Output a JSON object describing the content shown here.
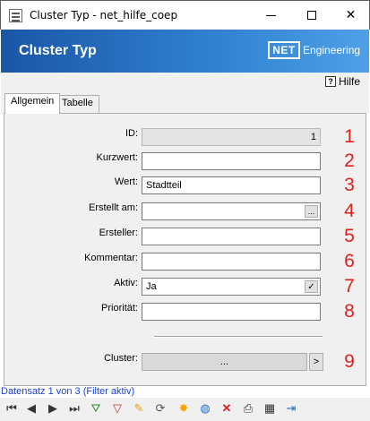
{
  "window": {
    "title": "Cluster Typ - net_hilfe_coep",
    "minimize_glyph": "—",
    "maximize_glyph": "□",
    "close_glyph": "✕"
  },
  "header": {
    "title": "Cluster Typ",
    "logo_text": "NET",
    "logo_suffix": "Engineering",
    "brand_gradient": [
      "#1a56a6",
      "#4ea0e6"
    ]
  },
  "help": {
    "label": "Hilfe",
    "icon": "help-icon",
    "icon_glyph": "?"
  },
  "tabs": [
    {
      "label": "Allgemein",
      "active": true
    },
    {
      "label": "Tabelle",
      "active": false
    }
  ],
  "form": {
    "id": {
      "label": "ID:",
      "value": "1",
      "number": "1"
    },
    "kurzwert": {
      "label": "Kurzwert:",
      "value": "",
      "number": "2"
    },
    "wert": {
      "label": "Wert:",
      "value": "Stadtteil",
      "number": "3"
    },
    "erstellt_am": {
      "label": "Erstellt am:",
      "value": "",
      "button": "...",
      "number": "4"
    },
    "ersteller": {
      "label": "Ersteller:",
      "value": "",
      "number": "5"
    },
    "kommentar": {
      "label": "Kommentar:",
      "value": "",
      "number": "6"
    },
    "aktiv": {
      "label": "Aktiv:",
      "value": "Ja",
      "check_glyph": "✓",
      "number": "7"
    },
    "prioritaet": {
      "label": "Priorität:",
      "value": "",
      "number": "8"
    },
    "cluster": {
      "label": "Cluster:",
      "button": "...",
      "nav": ">",
      "number": "9"
    },
    "annotation_color": "#e0201a"
  },
  "status": {
    "text": "Datensatz 1 von 3 (Filter aktiv)"
  },
  "toolbar": [
    {
      "icon": "first-record-icon",
      "glyph": "⏮"
    },
    {
      "icon": "previous-record-icon",
      "glyph": "◀"
    },
    {
      "icon": "next-record-icon",
      "glyph": "▶"
    },
    {
      "icon": "last-record-icon",
      "glyph": "⏭"
    },
    {
      "icon": "add-filter-icon",
      "glyph": "⛛"
    },
    {
      "icon": "filter-icon",
      "glyph": "▽"
    },
    {
      "icon": "edit-icon",
      "glyph": "✎"
    },
    {
      "icon": "refresh-icon",
      "glyph": "⟳"
    },
    {
      "icon": "new-record-icon",
      "glyph": "✸"
    },
    {
      "icon": "web-icon",
      "glyph": "◍"
    },
    {
      "icon": "delete-icon",
      "glyph": "✕"
    },
    {
      "icon": "print-icon",
      "glyph": "⎙"
    },
    {
      "icon": "table-icon",
      "glyph": "▦"
    },
    {
      "icon": "exit-icon",
      "glyph": "⇥"
    }
  ]
}
